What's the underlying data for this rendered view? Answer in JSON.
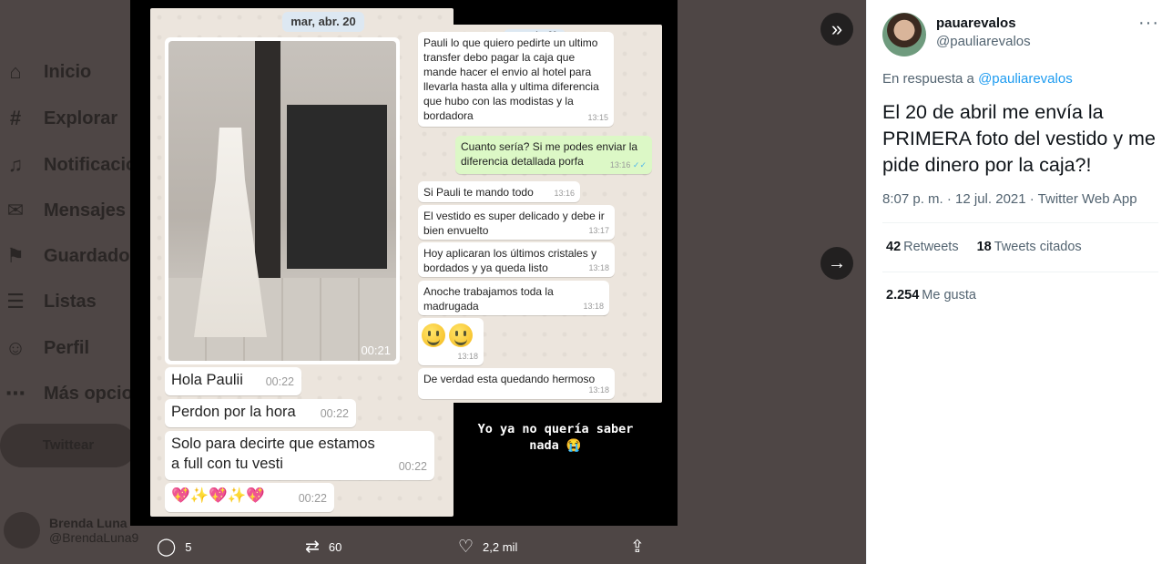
{
  "background": {
    "nav_items": [
      {
        "label": "Inicio",
        "icon": "home-icon",
        "glyph": "⌂"
      },
      {
        "label": "Explorar",
        "icon": "hashtag-icon",
        "glyph": "#"
      },
      {
        "label": "Notificacio",
        "icon": "bell-icon",
        "glyph": "🔔"
      },
      {
        "label": "Mensajes",
        "icon": "mail-icon",
        "glyph": "✉"
      },
      {
        "label": "Guardados",
        "icon": "bookmark-icon",
        "glyph": "⚑"
      },
      {
        "label": "Listas",
        "icon": "list-icon",
        "glyph": "☰"
      },
      {
        "label": "Perfil",
        "icon": "person-icon",
        "glyph": "☺"
      },
      {
        "label": "Más opcio",
        "icon": "more-icon",
        "glyph": "⋯"
      }
    ],
    "tweet_button": "Twittear",
    "profile_name": "Brenda Luna",
    "profile_handle": "@BrendaLuna9"
  },
  "media": {
    "left_chat": {
      "date": "mar, abr. 20",
      "photo_time": "00:21",
      "messages": [
        {
          "text": "Hola Paulii",
          "time": "00:22"
        },
        {
          "text": "Perdon por la hora",
          "time": "00:22"
        },
        {
          "text": "Solo para decirte que estamos a full con tu vesti",
          "time": "00:22"
        },
        {
          "text": "",
          "time": "00:22"
        }
      ]
    },
    "right_chat": {
      "date": "mar, abr. 20",
      "messages": [
        {
          "text": "Pauli lo que quiero pedirte un ultimo transfer debo pagar la caja que mande hacer el envio al hotel para llevarla hasta alla y ultima diferencia que hubo con las modistas y la bordadora",
          "time": "13:15",
          "type": "in"
        },
        {
          "text": "Cuanto sería? Si me podes enviar la diferencia detallada porfa",
          "time": "13:16",
          "type": "out"
        },
        {
          "text": "Si Pauli te mando todo",
          "time": "13:16",
          "type": "in"
        },
        {
          "text": "El vestido es super delicado y debe ir bien envuelto",
          "time": "13:17",
          "type": "in"
        },
        {
          "text": "Hoy aplicaran los últimos cristales y bordados y ya queda listo",
          "time": "13:18",
          "type": "in"
        },
        {
          "text": "Anoche trabajamos toda la madrugada",
          "time": "13:18",
          "type": "in"
        },
        {
          "text": "",
          "time": "13:18",
          "type": "in"
        },
        {
          "text": "De verdad esta quedando hermoso",
          "time": "13:18",
          "type": "in"
        }
      ]
    },
    "caption_line1": "Yo ya no quería saber",
    "caption_line2": "nada 😭"
  },
  "actions": {
    "replies": "5",
    "retweets": "60",
    "likes": "2,2 mil"
  },
  "tweet": {
    "name": "pauarevalos",
    "handle": "@pauliarevalos",
    "reply_prefix": "En respuesta a",
    "reply_to": "@pauliarevalos",
    "text": "El 20 de abril me envía la PRIMERA foto del vestido y me pide dinero por la caja?!",
    "meta": "8:07 p. m. · 12 jul. 2021 · Twitter Web App",
    "retweet_count": "42",
    "retweet_label": "Retweets",
    "quote_count": "18",
    "quote_label": "Tweets citados",
    "like_count": "2.254",
    "like_label": "Me gusta"
  }
}
